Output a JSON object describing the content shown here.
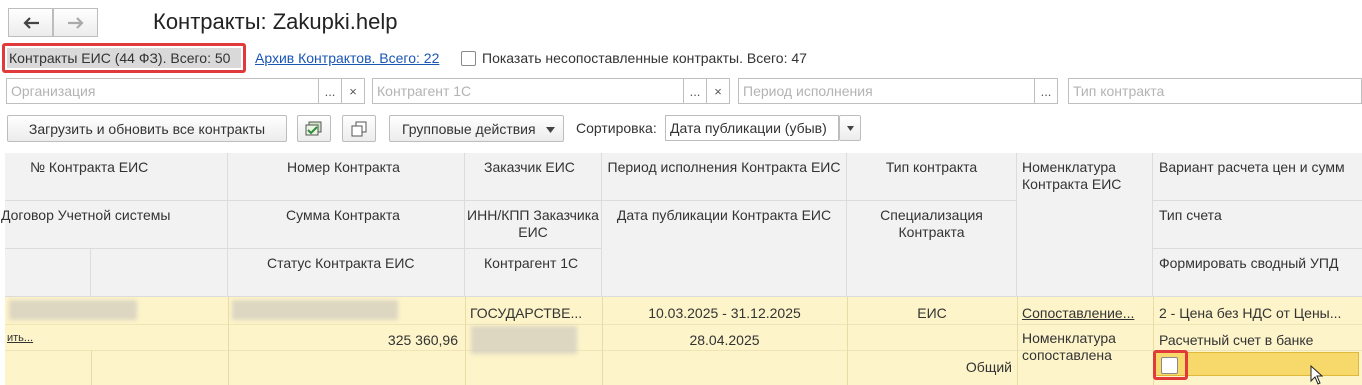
{
  "window": {
    "title": "Контракты: Zakupki.help"
  },
  "nav": {
    "back_icon": "arrow-left-icon",
    "forward_icon": "arrow-right-icon"
  },
  "tabs": {
    "active": "Контракты ЕИС (44 ФЗ). Всего: 50",
    "archive_link": "Архив Контрактов. Всего: 22",
    "unmatched_checkbox_label": "Показать несопоставленные контракты. Всего: 47"
  },
  "filters": {
    "organization_placeholder": "Организация",
    "counterparty_placeholder": "Контрагент 1С",
    "period_placeholder": "Период исполнения",
    "contract_type_placeholder": "Тип контракта",
    "choose_glyph": "...",
    "clear_glyph": "×"
  },
  "toolbar": {
    "load_button": "Загрузить и обновить все контракты",
    "group_actions_button": "Групповые действия",
    "sort_label": "Сортировка:",
    "sort_value": "Дата публикации (убыв)"
  },
  "table": {
    "headers": {
      "c1_r1": "№ Контракта ЕИС",
      "c1_r2": "Договор Учетной системы",
      "c2_r1": "Номер Контракта",
      "c2_r2": "Сумма Контракта",
      "c2_r3": "Статус Контракта ЕИС",
      "c3_r1": "Заказчик ЕИС",
      "c3_r2": "ИНН/КПП Заказчика ЕИС",
      "c3_r3": "Контрагент 1С",
      "c4_r1": "Период исполнения Контракта ЕИС",
      "c4_r2": "Дата публикации Контракта ЕИС",
      "c5_r1": "Тип контракта",
      "c5_r2": "Специализация Контракта",
      "c6_r1": "Номенклатура Контракта ЕИС",
      "c7_r1": "Вариант расчета цен и сумм",
      "c7_r2": "Тип счета",
      "c7_r3": "Формировать сводный УПД"
    },
    "row": {
      "contract_link": "ить...",
      "amount": "325 360,96",
      "customer": "ГОСУДАРСТВЕ...",
      "period": "10.03.2025 - 31.12.2025",
      "published": "28.04.2025",
      "type": "ЕИС",
      "specialization": "Общий",
      "nomenclature_link": "Сопоставление...",
      "nomenclature_status": "Номенклатура сопоставлена",
      "price_variant": "2 - Цена без НДС от Цены...",
      "account_type": "Расчетный счет в банке",
      "combined_upd_checked": false
    }
  },
  "colors": {
    "highlight": "#e03a3a",
    "row_bg": "#fdf4c9",
    "link": "#1a56b6"
  }
}
